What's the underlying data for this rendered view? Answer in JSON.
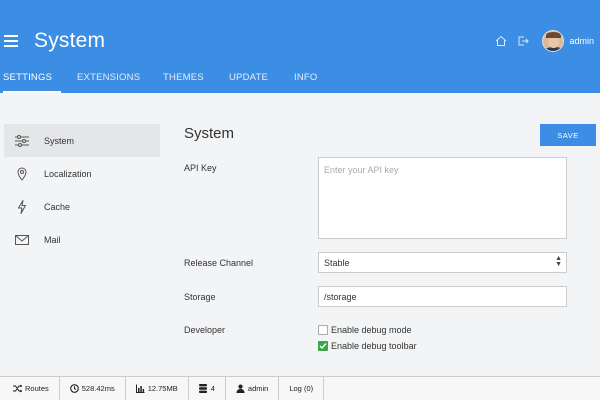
{
  "app": {
    "title": "System",
    "user": "admin"
  },
  "tabs": [
    {
      "label": "Settings"
    },
    {
      "label": "Extensions"
    },
    {
      "label": "Themes"
    },
    {
      "label": "Update"
    },
    {
      "label": "Info"
    }
  ],
  "sidebar": {
    "items": [
      {
        "label": "System",
        "icon": "sliders-icon"
      },
      {
        "label": "Localization",
        "icon": "location-pin-icon"
      },
      {
        "label": "Cache",
        "icon": "lightning-icon"
      },
      {
        "label": "Mail",
        "icon": "envelope-icon"
      }
    ]
  },
  "main": {
    "title": "System",
    "save_label": "SAVE",
    "api_key": {
      "label": "API Key",
      "placeholder": "Enter your API key",
      "value": ""
    },
    "release_channel": {
      "label": "Release Channel",
      "value": "Stable"
    },
    "storage": {
      "label": "Storage",
      "value": "/storage"
    },
    "developer": {
      "label": "Developer",
      "options": [
        {
          "label": "Enable debug mode",
          "checked": false
        },
        {
          "label": "Enable debug toolbar",
          "checked": true
        }
      ]
    }
  },
  "debugbar": {
    "routes": "Routes",
    "time": "528.42ms",
    "memory": "12.75MB",
    "queries": "4",
    "user": "admin",
    "log": "Log (0)"
  },
  "colors": {
    "accent": "#3b8ee3",
    "check": "#3aa64a"
  }
}
